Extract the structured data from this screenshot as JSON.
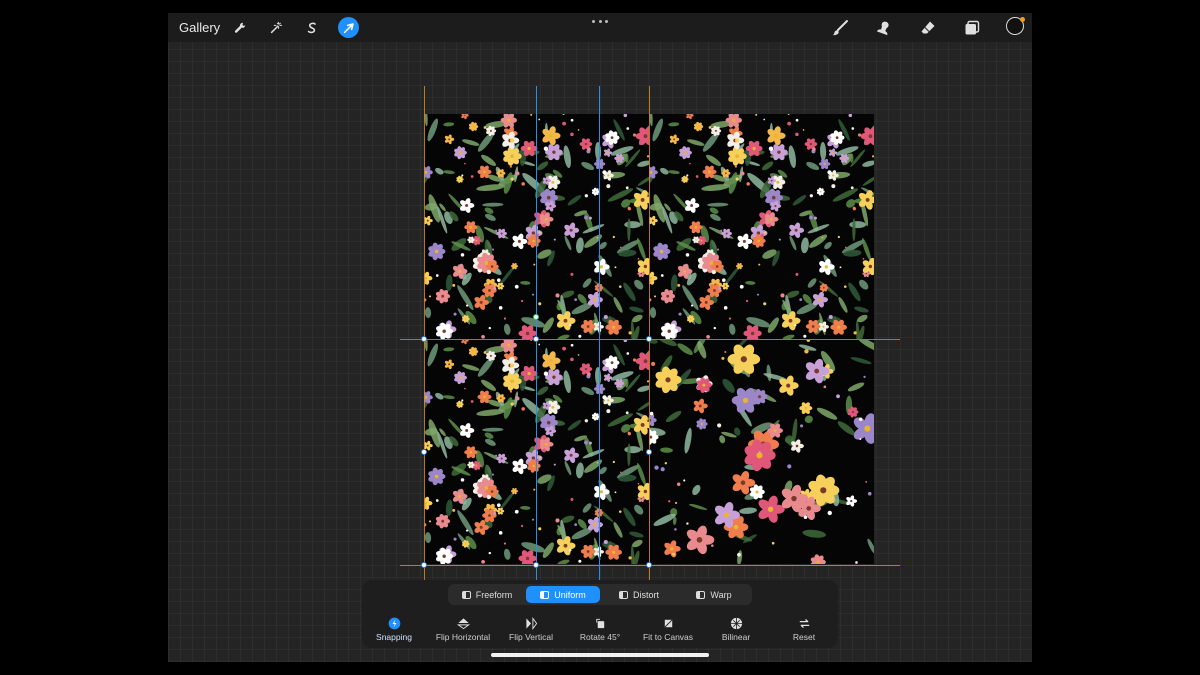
{
  "topbar": {
    "gallery_label": "Gallery",
    "left_icons": [
      "wrench-icon",
      "magic-wand-icon",
      "selection-s-icon",
      "transform-arrow-icon"
    ],
    "right_icons": [
      "brush-icon",
      "smudge-icon",
      "eraser-icon",
      "layers-icon",
      "color-swatch"
    ],
    "accent_color": "#1e90ff",
    "color_swatch_fill": "#111111",
    "color_dot": "#f0a020"
  },
  "canvas": {
    "background_color": "#050505",
    "guide_color_blue": "#2a8fe6",
    "guide_color_orange": "#d98a1e"
  },
  "transform_modes": {
    "items": [
      {
        "label": "Freeform",
        "active": false
      },
      {
        "label": "Uniform",
        "active": true
      },
      {
        "label": "Distort",
        "active": false
      },
      {
        "label": "Warp",
        "active": false
      }
    ]
  },
  "actions": {
    "items": [
      {
        "label": "Snapping",
        "icon": "snapping-icon",
        "on": true
      },
      {
        "label": "Flip Horizontal",
        "icon": "flip-horizontal-icon",
        "on": false
      },
      {
        "label": "Flip Vertical",
        "icon": "flip-vertical-icon",
        "on": false
      },
      {
        "label": "Rotate 45°",
        "icon": "rotate-icon",
        "on": false
      },
      {
        "label": "Fit to Canvas",
        "icon": "fit-to-canvas-icon",
        "on": false
      },
      {
        "label": "Bilinear",
        "icon": "bilinear-icon",
        "on": false
      },
      {
        "label": "Reset",
        "icon": "reset-icon",
        "on": false
      }
    ]
  }
}
